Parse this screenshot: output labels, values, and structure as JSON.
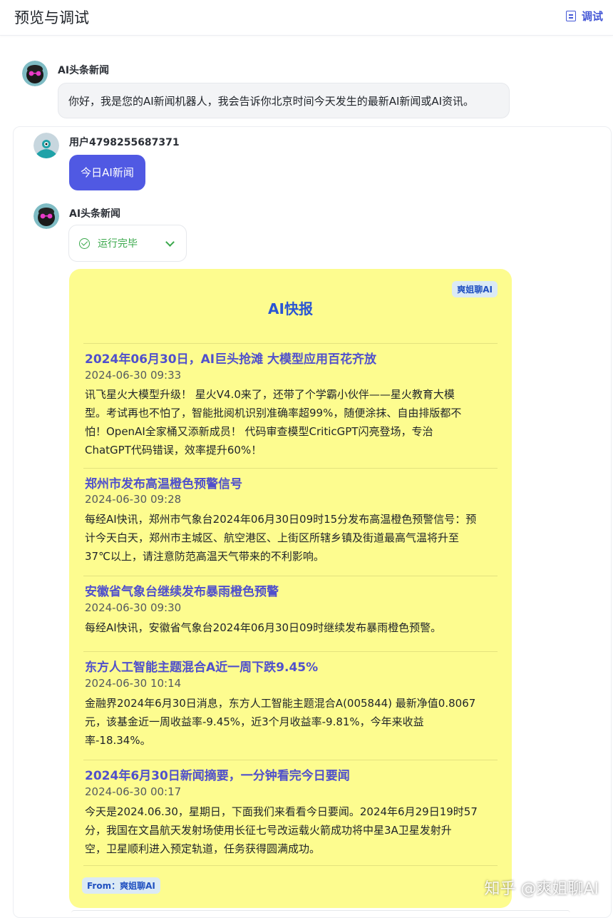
{
  "header": {
    "title": "预览与调试",
    "debug_label": "调试"
  },
  "bot": {
    "name": "AI头条新闻",
    "greeting": "你好，我是您的AI新闻机器人，我会告诉你北京时间今天发生的最新AI新闻或AI资讯。"
  },
  "user": {
    "name": "用户4798255687371",
    "message": "今日AI新闻"
  },
  "reply": {
    "name": "AI头条新闻",
    "status": "运行完毕",
    "card": {
      "brand": "爽姐聊AI",
      "title": "AI快报",
      "from": "From：爽姐聊AI",
      "news": [
        {
          "title": "2024年06月30日，AI巨头抢滩 大模型应用百花齐放",
          "time": "2024-06-30 09:33",
          "lines": [
            "讯飞星火大模型升级！ 星火V4.0来了，还带了个学霸小伙伴——星火教育大模",
            "型。考试再也不怕了，智能批阅机识别准确率超99%，随便涂抹、自由排版都不",
            "怕！OpenAI全家桶又添新成员！ 代码审查模型CriticGPT闪亮登场，专治",
            "ChatGPT代码错误，效率提升60%！"
          ]
        },
        {
          "title": "郑州市发布高温橙色预警信号",
          "time": "2024-06-30 09:28",
          "lines": [
            "每经AI快讯，郑州市气象台2024年06月30日09时15分发布高温橙色预警信号：预",
            "计今天白天，郑州市主城区、航空港区、上街区所辖乡镇及街道最高气温将升至",
            "37℃以上，请注意防范高温天气带来的不利影响。"
          ]
        },
        {
          "title": "安徽省气象台继续发布暴雨橙色预警",
          "time": "2024-06-30 09:30",
          "lines": [
            "每经AI快讯，安徽省气象台2024年06月30日09时继续发布暴雨橙色预警。"
          ]
        },
        {
          "title": "东方人工智能主题混合A近一周下跌9.45%",
          "time": "2024-06-30 10:14",
          "lines": [
            "金融界2024年6月30日消息，东方人工智能主题混合A(005844) 最新净值0.8067",
            "元，该基金近一周收益率-9.45%，近3个月收益率-9.81%，今年来收益",
            "率-18.34%。"
          ]
        },
        {
          "title": "2024年6月30日新闻摘要，一分钟看完今日要闻",
          "time": "2024-06-30 00:17",
          "lines": [
            "今天是2024.06.30，星期日，下面我们来看看今日要闻。2024年6月29日19时57",
            "分，我国在文昌航天发射场使用长征七号改运载火箭成功将中星3A卫星发射升",
            "空，卫星顺利进入预定轨道，任务获得圆满成功。"
          ]
        }
      ]
    }
  },
  "watermark": "知乎 @爽姐聊AI"
}
